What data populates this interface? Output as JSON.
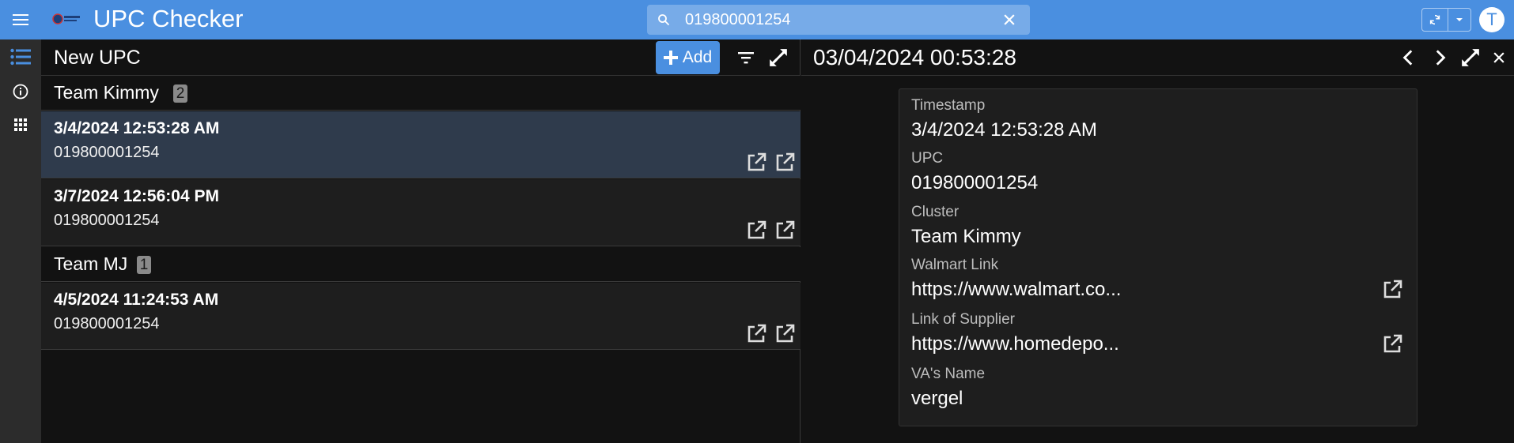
{
  "header": {
    "app_title": "UPC Checker",
    "search_value": "019800001254",
    "avatar_initial": "T"
  },
  "list_panel": {
    "title": "New UPC",
    "add_label": "Add",
    "groups": [
      {
        "name": "Team Kimmy",
        "count": "2",
        "rows": [
          {
            "timestamp": "3/4/2024 12:53:28 AM",
            "upc": "019800001254"
          },
          {
            "timestamp": "3/7/2024 12:56:04 PM",
            "upc": "019800001254"
          }
        ]
      },
      {
        "name": "Team MJ",
        "count": "1",
        "rows": [
          {
            "timestamp": "4/5/2024 11:24:53 AM",
            "upc": "019800001254"
          }
        ]
      }
    ]
  },
  "detail_panel": {
    "title": "03/04/2024 00:53:28",
    "fields": [
      {
        "label": "Timestamp",
        "value": "3/4/2024 12:53:28 AM"
      },
      {
        "label": "UPC",
        "value": "019800001254"
      },
      {
        "label": "Cluster",
        "value": "Team Kimmy"
      },
      {
        "label": "Walmart Link",
        "value": "https://www.walmart.co..."
      },
      {
        "label": "Link of Supplier",
        "value": "https://www.homedepo..."
      },
      {
        "label": "VA's Name",
        "value": "vergel"
      }
    ]
  },
  "colors": {
    "accent": "#4a8fe0",
    "selected_row": "#2f3b4c",
    "background": "#121212"
  },
  "icons": [
    "menu-icon",
    "logo-icon",
    "search-icon",
    "close-icon",
    "sync-icon",
    "chevron-down-icon",
    "list-icon",
    "info-icon",
    "apps-grid-icon",
    "plus-icon",
    "filter-icon",
    "expand-icon",
    "external-link-icon",
    "chevron-left-icon",
    "chevron-right-icon"
  ]
}
